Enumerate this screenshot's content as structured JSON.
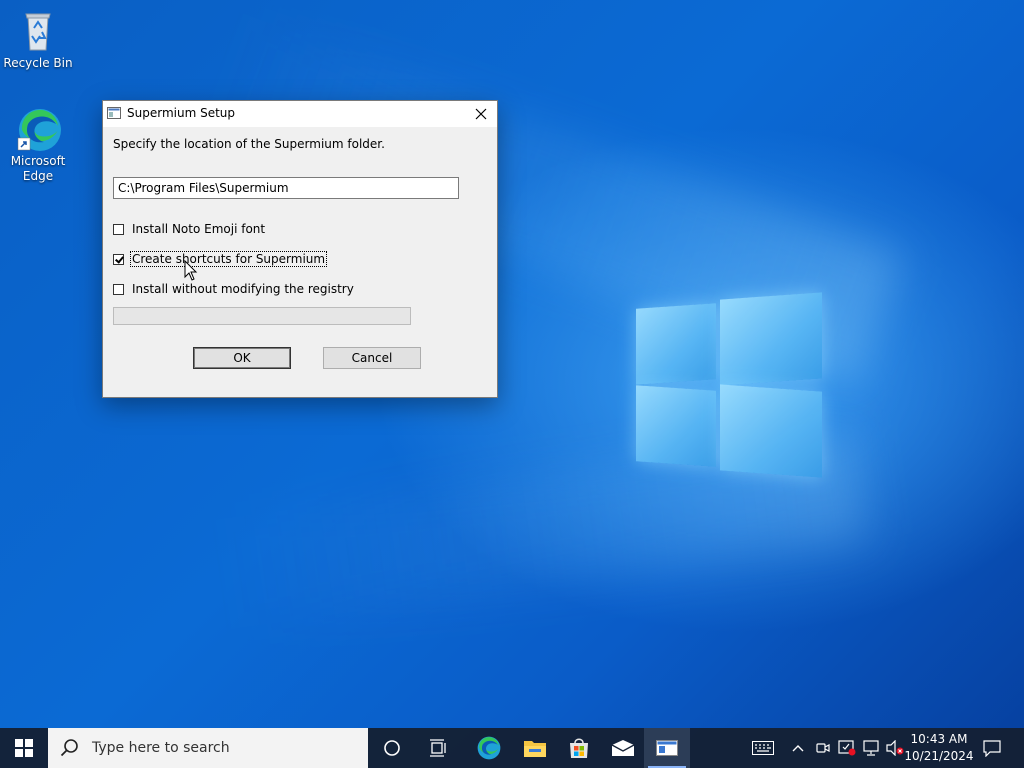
{
  "desktop": {
    "icons": [
      {
        "label": "Recycle Bin",
        "icon": "recycle-bin-icon"
      },
      {
        "label": "Microsoft\nEdge",
        "label_line1": "Microsoft",
        "label_line2": "Edge",
        "icon": "edge-icon"
      }
    ]
  },
  "dialog": {
    "title": "Supermium Setup",
    "instruction": "Specify the location of the Supermium folder.",
    "install_path": "C:\\Program Files\\Supermium",
    "options": [
      {
        "label": "Install Noto Emoji font",
        "checked": false
      },
      {
        "label": "Create shortcuts for Supermium",
        "checked": true
      },
      {
        "label": "Install without modifying the registry",
        "checked": false
      }
    ],
    "progress": 0,
    "ok_label": "OK",
    "cancel_label": "Cancel"
  },
  "taskbar": {
    "search_placeholder": "Type here to search",
    "pinned": [
      "task-view-icon",
      "edge-icon",
      "file-explorer-icon",
      "microsoft-store-icon",
      "mail-icon",
      "supermium-setup-icon"
    ],
    "active_app": "supermium-setup-icon",
    "tray_icons": [
      "keyboard-icon",
      "chevron-up-icon",
      "meet-now-icon",
      "security-icon",
      "network-icon",
      "volume-muted-icon"
    ],
    "time": "10:43 AM",
    "date": "10/21/2024"
  },
  "colors": {
    "desktop_blue": "#0a62cc",
    "taskbar": "#142034",
    "dialog_bg": "#f0f0f0",
    "accent": "#0078d7"
  }
}
